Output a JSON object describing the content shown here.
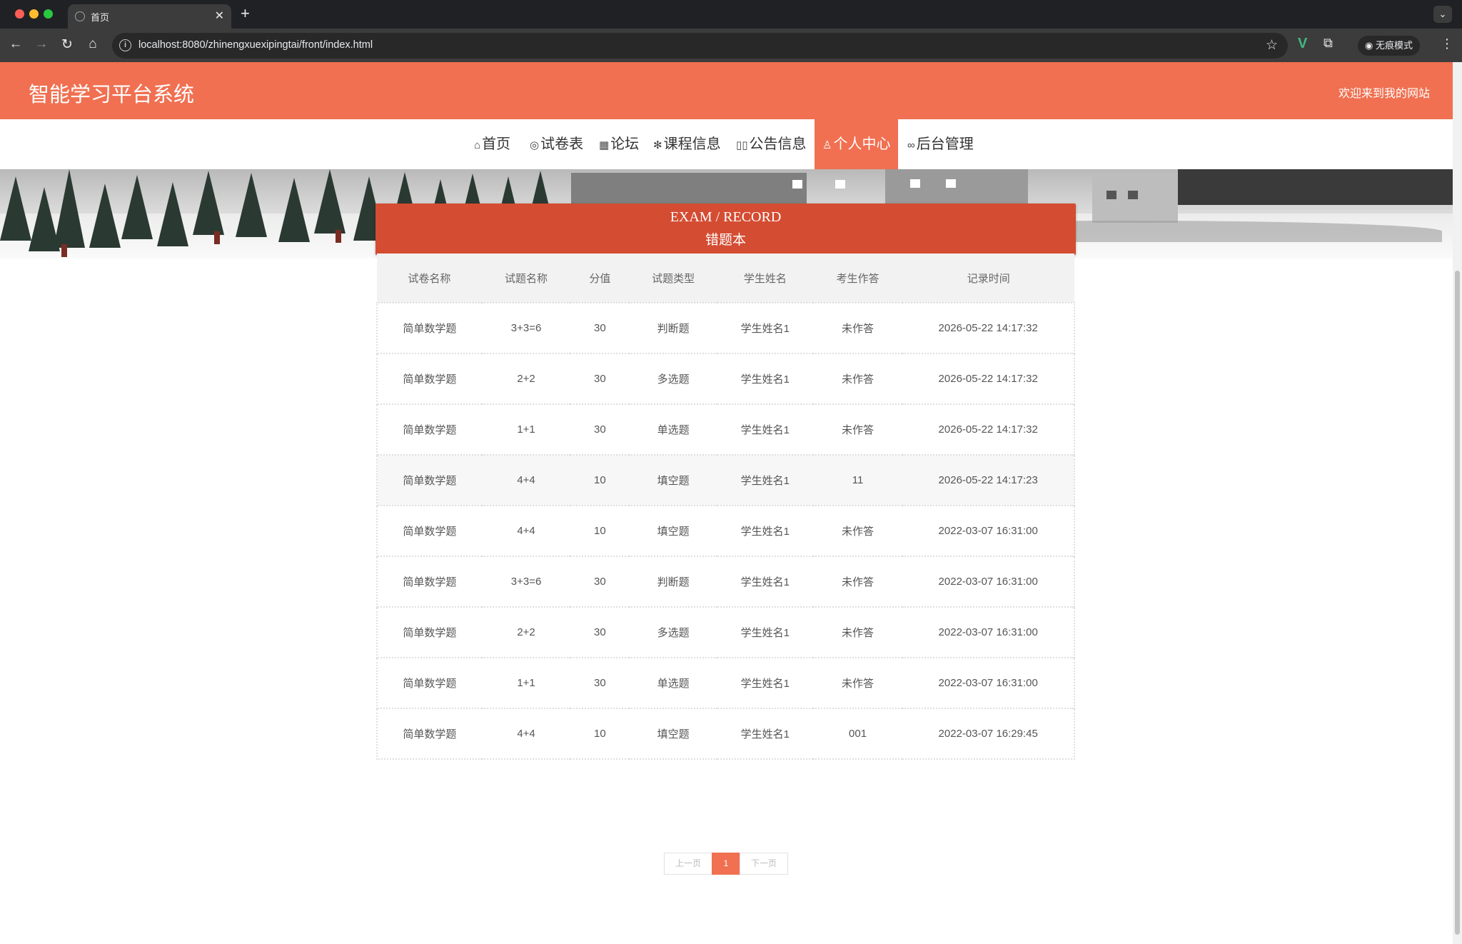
{
  "browser": {
    "tab_title": "首页",
    "url": "localhost:8080/zhinengxuexipingtai/front/index.html",
    "incognito_label": "无痕模式"
  },
  "site": {
    "title": "智能学习平台系统",
    "welcome": "欢迎来到我的网站"
  },
  "nav": [
    {
      "label": "首页",
      "icon": "home-icon"
    },
    {
      "label": "试卷表",
      "icon": "palette-icon"
    },
    {
      "label": "论坛",
      "icon": "calendar-icon"
    },
    {
      "label": "课程信息",
      "icon": "snowflake-icon"
    },
    {
      "label": "公告信息",
      "icon": "book-icon"
    },
    {
      "label": "个人中心",
      "icon": "user-icon",
      "active": true
    },
    {
      "label": "后台管理",
      "icon": "link-icon"
    }
  ],
  "section": {
    "title_en": "EXAM / RECORD",
    "title_cn": "错题本"
  },
  "table": {
    "headers": [
      "试卷名称",
      "试题名称",
      "分值",
      "试题类型",
      "学生姓名",
      "考生作答",
      "记录时间"
    ],
    "rows": [
      [
        "简单数学题",
        "3+3=6",
        "30",
        "判断题",
        "学生姓名1",
        "未作答",
        "2026-05-22 14:17:32"
      ],
      [
        "简单数学题",
        "2+2",
        "30",
        "多选题",
        "学生姓名1",
        "未作答",
        "2026-05-22 14:17:32"
      ],
      [
        "简单数学题",
        "1+1",
        "30",
        "单选题",
        "学生姓名1",
        "未作答",
        "2026-05-22 14:17:32"
      ],
      [
        "简单数学题",
        "4+4",
        "10",
        "填空题",
        "学生姓名1",
        "11",
        "2026-05-22 14:17:23"
      ],
      [
        "简单数学题",
        "4+4",
        "10",
        "填空题",
        "学生姓名1",
        "未作答",
        "2022-03-07 16:31:00"
      ],
      [
        "简单数学题",
        "3+3=6",
        "30",
        "判断题",
        "学生姓名1",
        "未作答",
        "2022-03-07 16:31:00"
      ],
      [
        "简单数学题",
        "2+2",
        "30",
        "多选题",
        "学生姓名1",
        "未作答",
        "2022-03-07 16:31:00"
      ],
      [
        "简单数学题",
        "1+1",
        "30",
        "单选题",
        "学生姓名1",
        "未作答",
        "2022-03-07 16:31:00"
      ],
      [
        "简单数学题",
        "4+4",
        "10",
        "填空题",
        "学生姓名1",
        "001",
        "2022-03-07 16:29:45"
      ]
    ]
  },
  "pager": {
    "prev": "上一页",
    "current": "1",
    "next": "下一页"
  },
  "colors": {
    "accent": "#f07051",
    "title_box": "#d44c32"
  }
}
